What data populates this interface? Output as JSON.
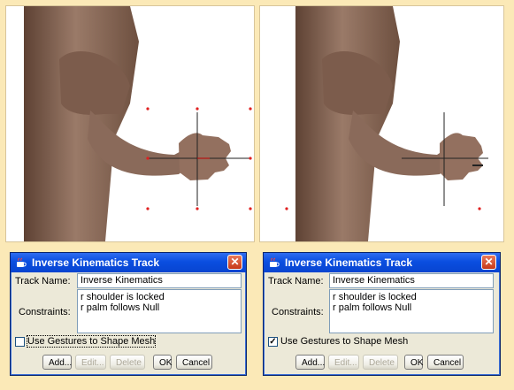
{
  "panels": [
    {
      "dialog": {
        "title": "Inverse Kinematics Track",
        "close_glyph": "✕",
        "track_name_label": "Track Name:",
        "track_name_value": "Inverse Kinematics",
        "constraints_label": "Constraints:",
        "constraints": [
          "r shoulder is locked",
          "r palm follows Null"
        ],
        "checkbox_label": "Use Gestures to Shape Mesh",
        "checkbox_checked": false,
        "checkbox_mark": "",
        "buttons": {
          "add": "Add...",
          "edit": "Edit...",
          "delete": "Delete",
          "ok": "OK",
          "cancel": "Cancel"
        }
      }
    },
    {
      "dialog": {
        "title": "Inverse Kinematics Track",
        "close_glyph": "✕",
        "track_name_label": "Track Name:",
        "track_name_value": "Inverse Kinematics",
        "constraints_label": "Constraints:",
        "constraints": [
          "r shoulder is locked",
          "r palm follows Null"
        ],
        "checkbox_label": "Use Gestures to Shape Mesh",
        "checkbox_checked": true,
        "checkbox_mark": "✓",
        "buttons": {
          "add": "Add...",
          "edit": "Edit...",
          "delete": "Delete",
          "ok": "OK",
          "cancel": "Cancel"
        }
      }
    }
  ],
  "colors": {
    "page_bg": "#fbe9b7",
    "skin": "#8a6a5a",
    "title_bar": "#0a4ee0",
    "null_marker": "#e02020"
  },
  "icons": {
    "title": "java-cup-icon",
    "close": "close-icon",
    "markers": "null-target-marker-icon"
  }
}
